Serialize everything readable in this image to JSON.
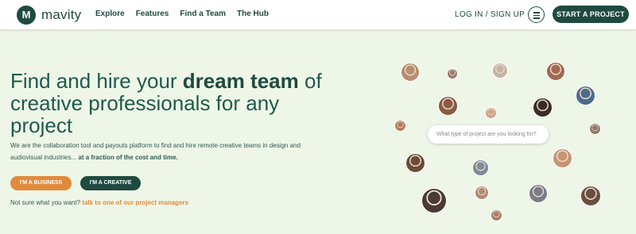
{
  "brand": {
    "logo_letter": "M",
    "name": "mavity"
  },
  "nav": {
    "links": [
      "Explore",
      "Features",
      "Find a Team",
      "The Hub"
    ],
    "login_label": "LOG IN / SIGN UP",
    "cta_label": "START A PROJECT"
  },
  "hero": {
    "headline_plain_1": "Find and hire your ",
    "headline_bold": "dream team",
    "headline_plain_2": " of creative professionals for any project",
    "subtext": "We are the collaboration tool and payouts platform to find and hire remote creative teams in design and audiovisual industries... ",
    "subtext_bold": "at a fraction of the cost and time.",
    "business_button": "I'M A BUSINESS",
    "creative_button": "I'M A CREATIVE",
    "not_sure_text": "Not sure what you want? ",
    "not_sure_link": "talk to one of our project managers"
  },
  "search": {
    "placeholder": "What type of project are you looking for?"
  },
  "colors": {
    "brand_green": "#1f4a3f",
    "accent_orange": "#e28a3b",
    "background": "#eef6e8"
  },
  "avatars": [
    "avatar-photo",
    "avatar-photo",
    "avatar-photo",
    "avatar-photo",
    "avatar-photo",
    "avatar-photo",
    "avatar-photo",
    "avatar-photo",
    "avatar-photo",
    "avatar-photo",
    "avatar-photo",
    "avatar-photo",
    "avatar-photo",
    "avatar-photo",
    "avatar-photo",
    "avatar-photo",
    "avatar-photo",
    "avatar-photo",
    "avatar-photo",
    "avatar-photo"
  ]
}
